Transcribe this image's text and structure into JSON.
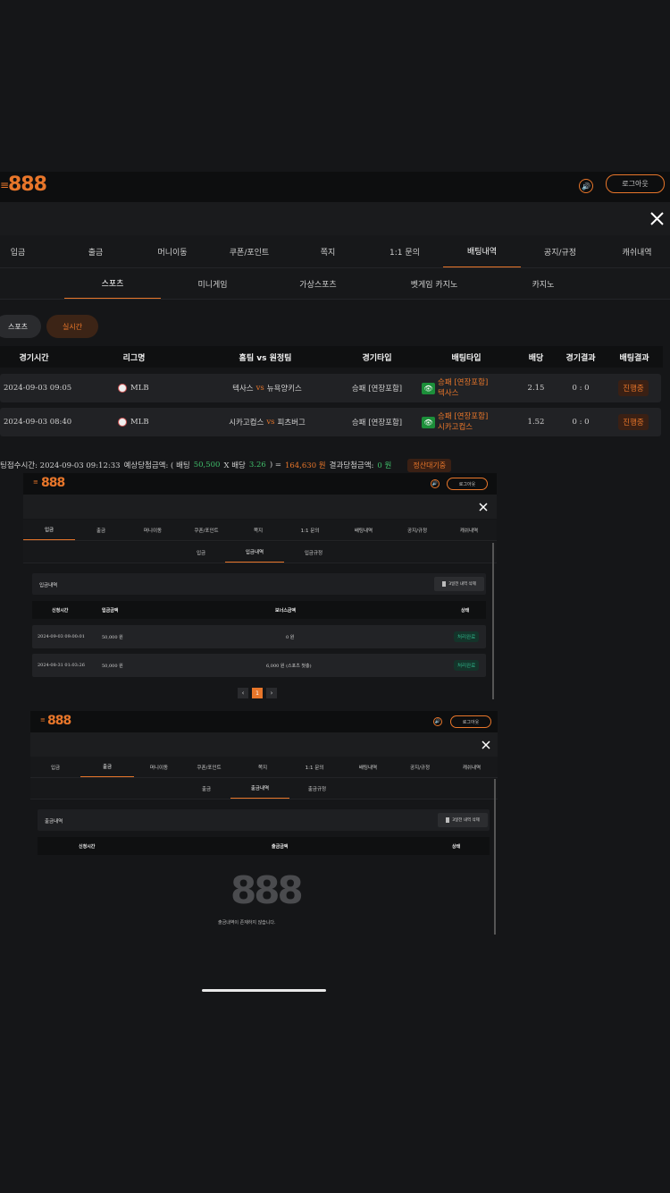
{
  "brand": {
    "logo": "888",
    "accent": "#e8762a",
    "menu_icon": "≡"
  },
  "header": {
    "logout_label": "로그아웃"
  },
  "nav": {
    "tabs": [
      "입금",
      "출금",
      "머니이동",
      "쿠폰/포인트",
      "쪽지",
      "1:1 문의",
      "배팅내역",
      "공지/규정",
      "캐쉬내역"
    ],
    "active_index": 6
  },
  "subnav": {
    "tabs": [
      "스포츠",
      "미니게임",
      "가상스포츠",
      "벳게임 카지노",
      "카지노"
    ],
    "active_index": 0
  },
  "filters": {
    "sports": "스포츠",
    "live": "실시간"
  },
  "bet_table": {
    "headers": [
      "경기시간",
      "리그명",
      "홈팀 vs 원정팀",
      "경기타입",
      "배팅타입",
      "배당",
      "경기결과",
      "배팅결과"
    ],
    "rows": [
      {
        "time": "2024-09-03 09:05",
        "league": "MLB",
        "home": "텍사스",
        "vs": "vs",
        "away": "뉴욕양키스",
        "type": "승패 [연장포함]",
        "bet_line1": "승패 [연장포함]",
        "bet_line2": "텍사스",
        "odds": "2.15",
        "result": "0 : 0",
        "status": "진행중"
      },
      {
        "time": "2024-09-03 08:40",
        "league": "MLB",
        "home": "시카고컵스",
        "vs": "vs",
        "away": "피츠버그",
        "type": "승패 [연장포함]",
        "bet_line1": "승패 [연장포함]",
        "bet_line2": "시카고컵스",
        "odds": "1.52",
        "result": "0 : 0",
        "status": "진행중"
      }
    ]
  },
  "summary": {
    "prefix": "팅접수시간: 2024-09-03 09:12:33",
    "expected_label": "예상당첨금액: ( 배팅",
    "bet_amount": "50,500",
    "x_label": "X 배당",
    "odds": "3.26",
    "eq": ") =",
    "win_amount": "164,630 원",
    "result_label": "결과당첨금액:",
    "result_amount": "0 원",
    "status": "정산대기중"
  },
  "deposit_shot": {
    "subtabs": [
      "입금",
      "입금내역",
      "입금규정"
    ],
    "active_sub": 1,
    "section_title": "입금내역",
    "delete_btn": "3일전 내역 삭제",
    "headers": [
      "신청시간",
      "입금금액",
      "보너스금액",
      "상태"
    ],
    "rows": [
      {
        "time": "2024-09-03 09:00:01",
        "amount": "50,000 원",
        "bonus": "0 원",
        "status": "처리완료"
      },
      {
        "time": "2024-08-31 01:03:26",
        "amount": "50,000 원",
        "bonus": "6,000 원 (스포츠 첫충)",
        "status": "처리완료"
      }
    ],
    "pagination": {
      "prev": "‹",
      "current": "1",
      "next": "›"
    }
  },
  "withdraw_shot": {
    "subtabs": [
      "출금",
      "출금내역",
      "출금규정"
    ],
    "active_sub": 1,
    "section_title": "출금내역",
    "delete_btn": "3일전 내역 삭제",
    "headers": [
      "신청시간",
      "출금금액",
      "상태"
    ],
    "empty_text": "출금내역이 존재하지 않습니다."
  }
}
